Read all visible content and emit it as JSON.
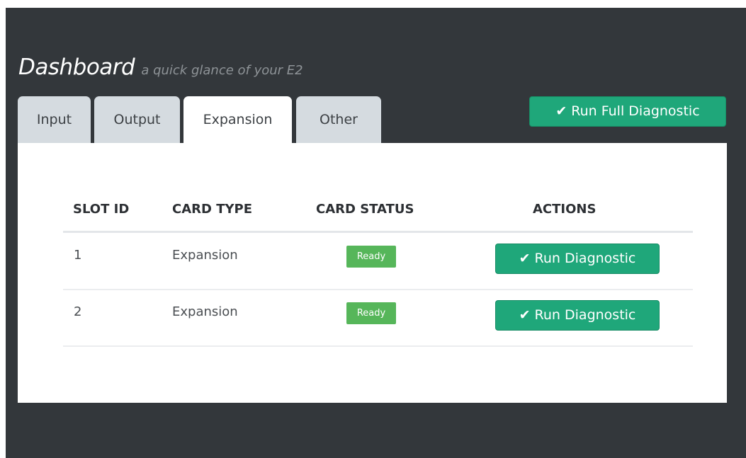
{
  "header": {
    "title": "Dashboard",
    "subtitle": "a quick glance of your E2"
  },
  "tabs": [
    {
      "label": "Input",
      "active": false
    },
    {
      "label": "Output",
      "active": false
    },
    {
      "label": "Expansion",
      "active": true
    },
    {
      "label": "Other",
      "active": false
    }
  ],
  "toolbar": {
    "full_diagnostic_label": "Run Full Diagnostic",
    "check_icon": "check-icon"
  },
  "table": {
    "columns": [
      "SLOT ID",
      "CARD TYPE",
      "CARD STATUS",
      "ACTIONS"
    ],
    "rows": [
      {
        "slot_id": "1",
        "card_type": "Expansion",
        "status": "Ready",
        "action": "Run Diagnostic"
      },
      {
        "slot_id": "2",
        "card_type": "Expansion",
        "status": "Ready",
        "action": "Run Diagnostic"
      }
    ]
  },
  "colors": {
    "background": "#33373b",
    "accent_button": "#1fa77a",
    "status_ready": "#56b65a",
    "tab_inactive": "#d5dbe0"
  }
}
